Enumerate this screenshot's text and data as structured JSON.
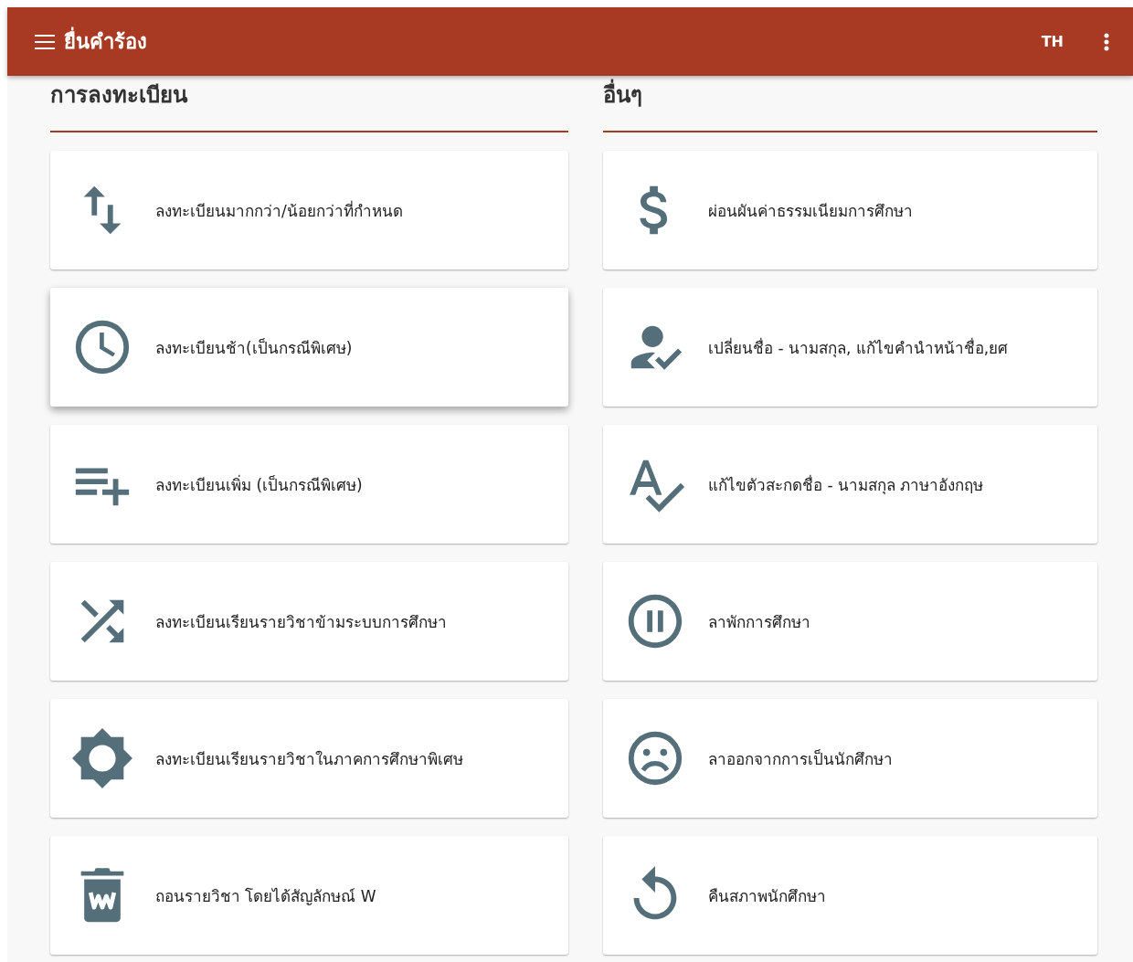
{
  "app_bar": {
    "title": "ยื่นคำร้อง",
    "language": "TH"
  },
  "sections": [
    {
      "title": "การลงทะเบียน",
      "items": [
        {
          "label": "ลงทะเบียนมากกว่า/น้อยกว่าที่กำหนด",
          "hovered": false
        },
        {
          "label": "ลงทะเบียนช้า(เป็นกรณีพิเศษ)",
          "hovered": true
        },
        {
          "label": "ลงทะเบียนเพิ่ม (เป็นกรณีพิเศษ)",
          "hovered": false
        },
        {
          "label": "ลงทะเบียนเรียนรายวิชาข้ามระบบการศึกษา",
          "hovered": false
        },
        {
          "label": "ลงทะเบียนเรียนรายวิชาในภาคการศึกษาพิเศษ",
          "hovered": false
        },
        {
          "label": "ถอนรายวิชา โดยได้สัญลักษณ์ W",
          "hovered": false
        }
      ]
    },
    {
      "title": "อื่นๆ",
      "items": [
        {
          "label": "ผ่อนผันค่าธรรมเนียมการศึกษา",
          "hovered": false
        },
        {
          "label": "เปลี่ยนชื่อ - นามสกุล, แก้ไขคำนำหน้าชื่อ,ยศ",
          "hovered": false
        },
        {
          "label": "แก้ไขตัวสะกดชื่อ - นามสกุล ภาษาอังกฤษ",
          "hovered": false
        },
        {
          "label": "ลาพักการศึกษา",
          "hovered": false
        },
        {
          "label": "ลาออกจากการเป็นนักศึกษา",
          "hovered": false
        },
        {
          "label": "คืนสภาพนักศึกษา",
          "hovered": false
        }
      ]
    }
  ]
}
